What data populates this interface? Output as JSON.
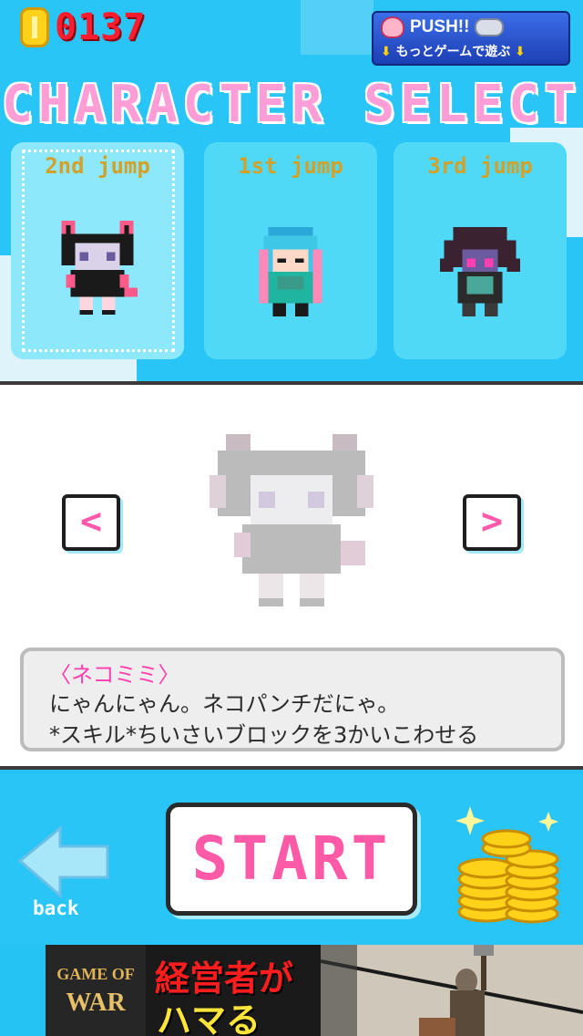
{
  "coins": {
    "count": "0137"
  },
  "push_banner": {
    "title": "PUSH!!",
    "subtitle": "もっとゲームで遊ぶ"
  },
  "title": "CHARACTER SELECT",
  "characters": [
    {
      "jump": "2nd jump",
      "selected": true
    },
    {
      "jump": "1st jump",
      "selected": false
    },
    {
      "jump": "3rd jump",
      "selected": false
    }
  ],
  "detail": {
    "name": "〈ネコミミ〉",
    "line1": "にゃんにゃん。ネコパンチだにゃ。",
    "line2": "*スキル*ちいさいブロックを3かいこわせる"
  },
  "nav": {
    "prev": "<",
    "next": ">"
  },
  "buttons": {
    "start": "START",
    "back": "back"
  },
  "ad": {
    "logo_line1": "GAME OF",
    "logo_line2": "WAR",
    "text1": "経営者が",
    "text2": "ハマる"
  },
  "colors": {
    "accent_pink": "#ff5aa8",
    "sky_blue": "#29c5f6",
    "coin_red": "#ff1d2d"
  }
}
